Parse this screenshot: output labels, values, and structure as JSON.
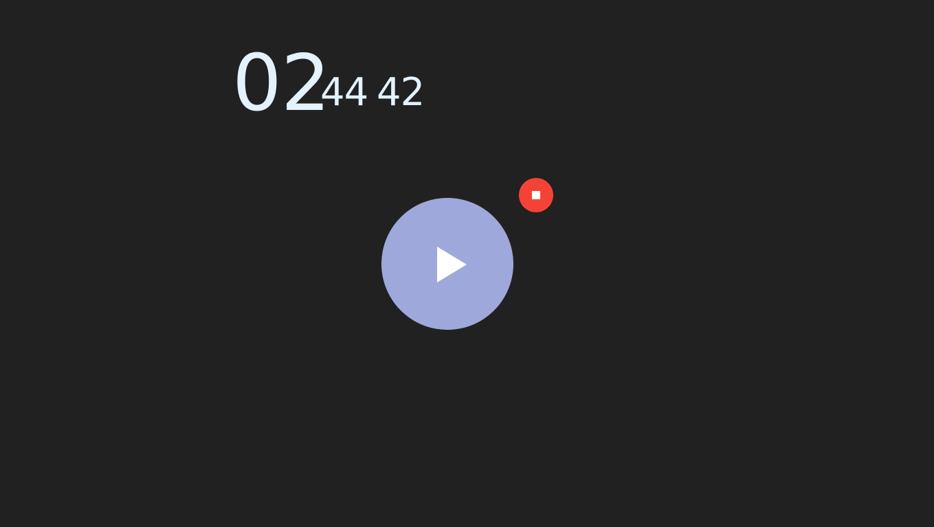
{
  "timer": {
    "hours": "02",
    "minutes": "44",
    "seconds": "42"
  },
  "controls": {
    "play": {
      "icon": "play-icon",
      "color": "#9fa8da"
    },
    "stop": {
      "icon": "stop-icon",
      "color": "#f44336"
    }
  },
  "theme": {
    "background": "#212121",
    "text": "#e3f2fd"
  }
}
